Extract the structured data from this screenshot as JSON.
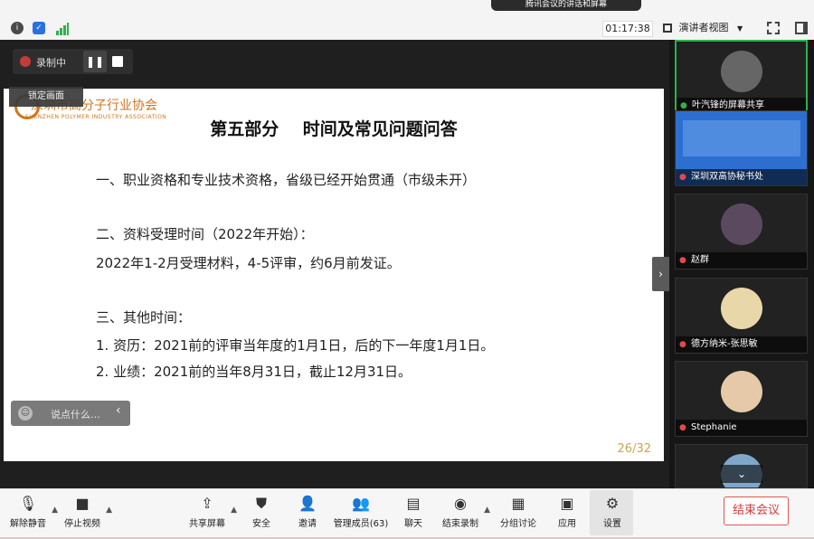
{
  "topbar": {
    "banner": "腾讯会议的讲话和屏幕",
    "timer": "01:17:38",
    "view_label": "演讲者视图",
    "colors": {
      "info": "#4a4a4a",
      "shield": "#2b6fe0",
      "signal": "#2bb24c"
    }
  },
  "recording": {
    "label": "录制中"
  },
  "lock_view": "锁定画面",
  "slide": {
    "logo_cn": "深圳市高分子行业协会",
    "logo_en": "SHENZHEN POLYMER INDUSTRY ASSOCIATION",
    "title": "第五部分    时间及常见问题问答",
    "lines": [
      "一、职业资格和专业技术资格，省级已经开始贯通（市级未开）",
      "二、资料受理时间（2022年开始）：",
      "2022年1-2月受理材料，4-5评审，约6月前发证。",
      "三、其他时间：",
      "1. 资历：2021前的评审当年度的1月1日，后的下一年度1月1日。",
      "2. 业绩：2021前的当年8月31日，截止12月31日。"
    ],
    "page": "26/32"
  },
  "chat": {
    "placeholder": "说点什么…"
  },
  "participants": [
    {
      "name": "叶汽锋的屏幕共享",
      "active": true
    },
    {
      "name": "深圳双高协秘书处",
      "active": false
    },
    {
      "name": "赵群",
      "active": false
    },
    {
      "name": "德方纳米-张思敏",
      "active": false
    },
    {
      "name": "Stephanie",
      "active": false
    }
  ],
  "toolbar": {
    "unmute": "解除静音",
    "stop_video": "停止视频",
    "share": "共享屏幕",
    "security": "安全",
    "invite": "邀请",
    "members": "管理成员(63)",
    "chat": "聊天",
    "stop_record": "结束录制",
    "breakout": "分组讨论",
    "apps": "应用",
    "settings": "设置",
    "end": "结束会议"
  }
}
